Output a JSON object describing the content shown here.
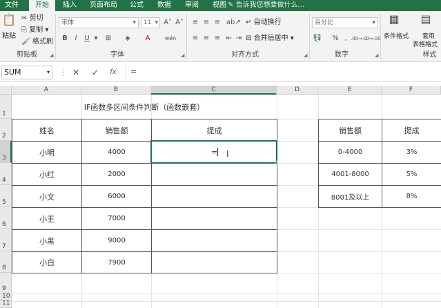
{
  "ribbon": {
    "tabs": [
      "文件",
      "开始",
      "插入",
      "页面布局",
      "公式",
      "数据",
      "审阅",
      "视图"
    ],
    "active_tab": "开始",
    "tell_me": "告诉我您想要做什么...",
    "clipboard": {
      "paste": "粘贴",
      "cut": "剪切",
      "copy": "复制",
      "format_painter": "格式刷",
      "label": "剪贴板"
    },
    "font": {
      "name_placeholder": "宋体",
      "size": "11",
      "label": "字体",
      "bold": "B",
      "italic": "I",
      "underline": "U",
      "grow": "A˄",
      "shrink": "A˅",
      "font_color": "A",
      "wen": "wén"
    },
    "alignment": {
      "wrap_text": "自动换行",
      "merge_center": "合并后居中",
      "label": "对齐方式"
    },
    "number": {
      "format": "百分比",
      "percent": "%",
      "comma": ",",
      "inc_decimal": ".00→.0",
      "dec_decimal": ".0→.00",
      "label": "数字"
    },
    "styles": {
      "conditional": "条件格式",
      "table_format_1": "套用",
      "table_format_2": "表格格式",
      "label": "样式"
    }
  },
  "formula_bar": {
    "name_box": "SUM",
    "cancel": "✕",
    "enter": "✓",
    "fx": "fx",
    "content": "="
  },
  "columns": [
    "A",
    "B",
    "C",
    "D",
    "E",
    "F"
  ],
  "rows": [
    "1",
    "2",
    "3",
    "4",
    "5",
    "6",
    "7",
    "8",
    "9",
    "10",
    "11"
  ],
  "sheet": {
    "title": "IF函数多区间条件判断（函数嵌套）",
    "headers": [
      "姓名",
      "销售额",
      "提成"
    ],
    "data": [
      [
        "小明",
        "4000",
        "="
      ],
      [
        "小红",
        "2000",
        ""
      ],
      [
        "小文",
        "6000",
        ""
      ],
      [
        "小王",
        "7000",
        ""
      ],
      [
        "小黑",
        "9000",
        ""
      ],
      [
        "小白",
        "7900",
        ""
      ]
    ],
    "lookup_headers": [
      "销售额",
      "提成"
    ],
    "lookup": [
      [
        "0-4000",
        "3%"
      ],
      [
        "4001-8000",
        "5%"
      ],
      [
        "8001及以上",
        "8%"
      ]
    ]
  },
  "colors": {
    "accent": "#217346"
  }
}
